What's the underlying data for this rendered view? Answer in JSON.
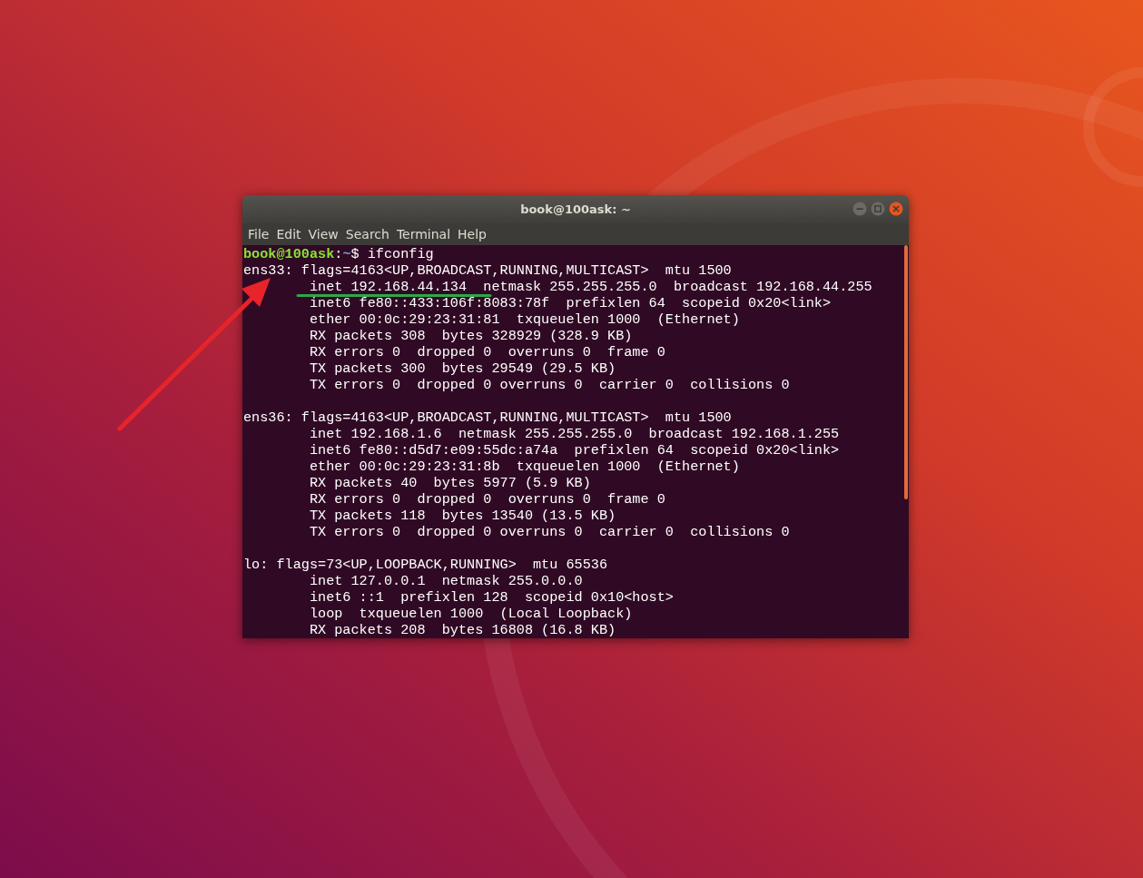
{
  "window": {
    "title": "book@100ask: ~"
  },
  "menu": [
    {
      "label": "File"
    },
    {
      "label": "Edit"
    },
    {
      "label": "View"
    },
    {
      "label": "Search"
    },
    {
      "label": "Terminal"
    },
    {
      "label": "Help"
    }
  ],
  "prompt": {
    "user_host": "book@100ask",
    "separator": ":",
    "path": "~",
    "command": "$ ifconfig"
  },
  "blocks": [
    [
      "ens33: flags=4163<UP,BROADCAST,RUNNING,MULTICAST>  mtu 1500",
      "        inet 192.168.44.134  netmask 255.255.255.0  broadcast 192.168.44.255",
      "        inet6 fe80::433:106f:8083:78f  prefixlen 64  scopeid 0x20<link>",
      "        ether 00:0c:29:23:31:81  txqueuelen 1000  (Ethernet)",
      "        RX packets 308  bytes 328929 (328.9 KB)",
      "        RX errors 0  dropped 0  overruns 0  frame 0",
      "        TX packets 300  bytes 29549 (29.5 KB)",
      "        TX errors 0  dropped 0 overruns 0  carrier 0  collisions 0"
    ],
    [
      "ens36: flags=4163<UP,BROADCAST,RUNNING,MULTICAST>  mtu 1500",
      "        inet 192.168.1.6  netmask 255.255.255.0  broadcast 192.168.1.255",
      "        inet6 fe80::d5d7:e09:55dc:a74a  prefixlen 64  scopeid 0x20<link>",
      "        ether 00:0c:29:23:31:8b  txqueuelen 1000  (Ethernet)",
      "        RX packets 40  bytes 5977 (5.9 KB)",
      "        RX errors 0  dropped 0  overruns 0  frame 0",
      "        TX packets 118  bytes 13540 (13.5 KB)",
      "        TX errors 0  dropped 0 overruns 0  carrier 0  collisions 0"
    ],
    [
      "lo: flags=73<UP,LOOPBACK,RUNNING>  mtu 65536",
      "        inet 127.0.0.1  netmask 255.0.0.0",
      "        inet6 ::1  prefixlen 128  scopeid 0x10<host>",
      "        loop  txqueuelen 1000  (Local Loopback)",
      "        RX packets 208  bytes 16808 (16.8 KB)"
    ]
  ]
}
